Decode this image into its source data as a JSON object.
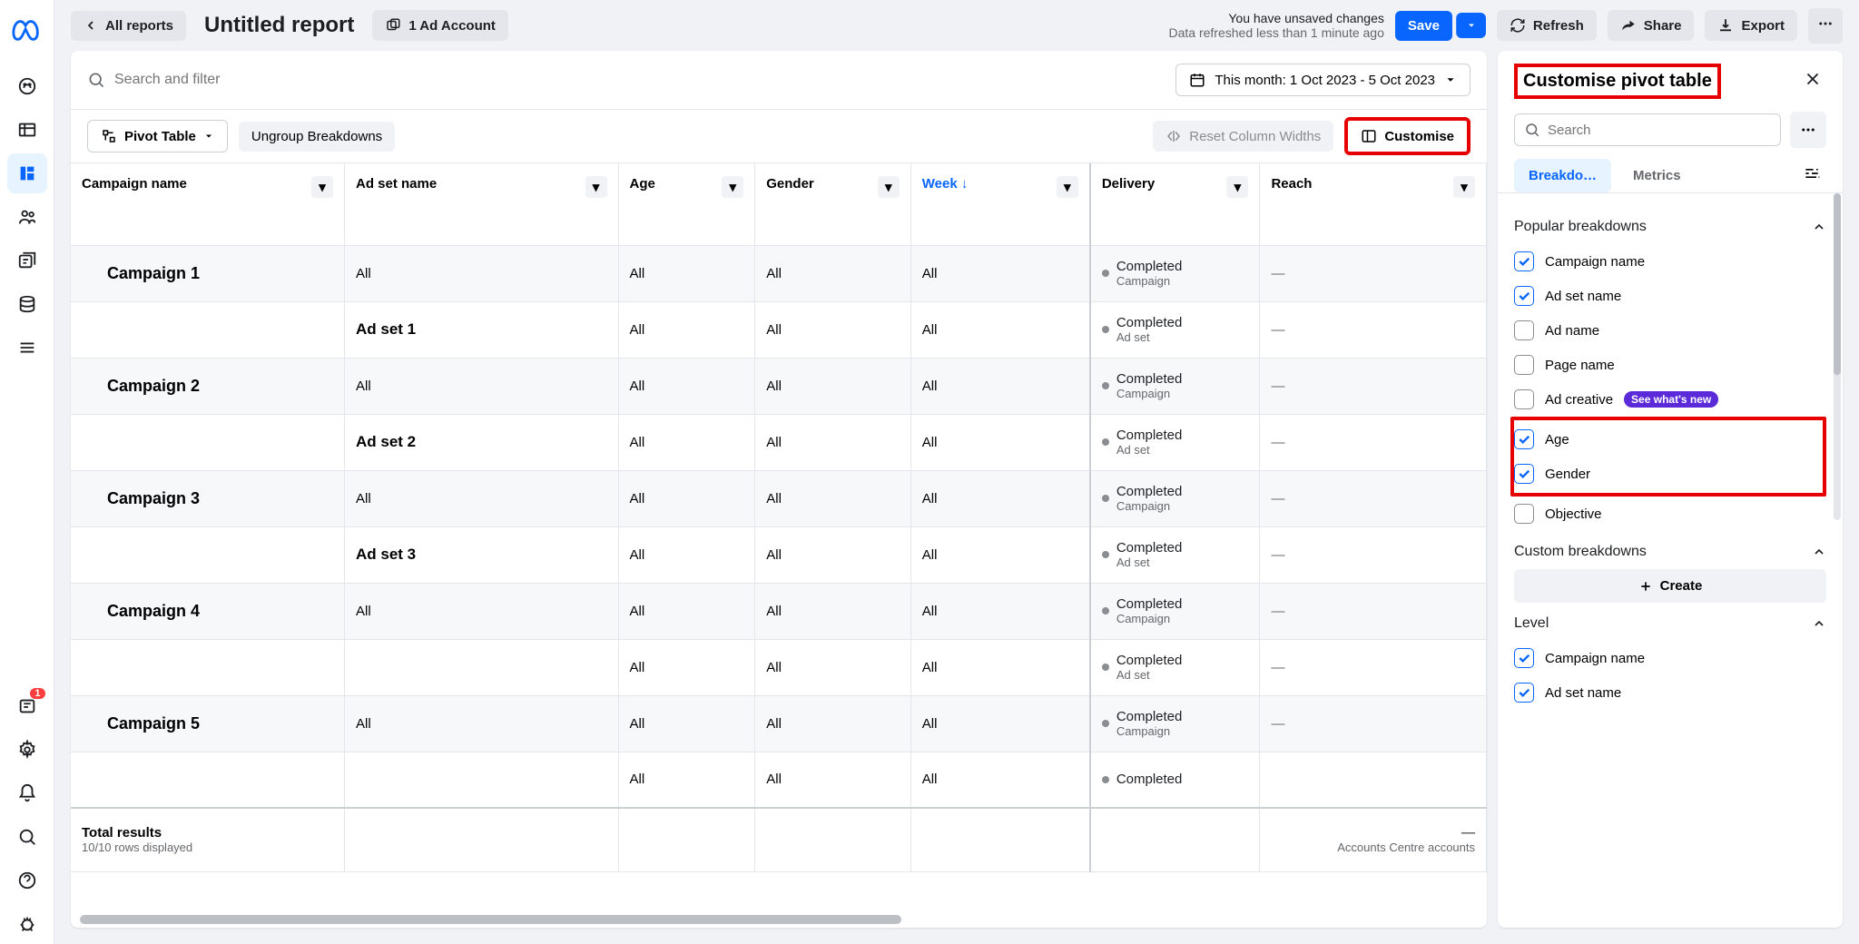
{
  "header": {
    "all_reports": "All reports",
    "title": "Untitled report",
    "ad_account": "1 Ad Account",
    "status_line1": "You have unsaved changes",
    "status_line2": "Data refreshed less than 1 minute ago",
    "save": "Save",
    "refresh": "Refresh",
    "share": "Share",
    "export": "Export"
  },
  "search": {
    "placeholder": "Search and filter",
    "date_range": "This month: 1 Oct 2023 - 5 Oct 2023"
  },
  "toolbar": {
    "pivot": "Pivot Table",
    "ungroup": "Ungroup Breakdowns",
    "reset_widths": "Reset Column Widths",
    "customise": "Customise"
  },
  "columns": {
    "campaign": "Campaign name",
    "adset": "Ad set name",
    "age": "Age",
    "gender": "Gender",
    "week": "Week ↓",
    "delivery": "Delivery",
    "reach": "Reach"
  },
  "rows": [
    {
      "type": "campaign",
      "campaign": "Campaign 1",
      "adset": "All",
      "age": "All",
      "gender": "All",
      "week": "All",
      "delivery": "Completed",
      "delivery_sub": "Campaign",
      "reach": "—"
    },
    {
      "type": "adset",
      "campaign": "",
      "adset": "Ad set 1",
      "age": "All",
      "gender": "All",
      "week": "All",
      "delivery": "Completed",
      "delivery_sub": "Ad set",
      "reach": "—"
    },
    {
      "type": "campaign",
      "campaign": "Campaign 2",
      "adset": "All",
      "age": "All",
      "gender": "All",
      "week": "All",
      "delivery": "Completed",
      "delivery_sub": "Campaign",
      "reach": "—"
    },
    {
      "type": "adset",
      "campaign": "",
      "adset": "Ad set 2",
      "age": "All",
      "gender": "All",
      "week": "All",
      "delivery": "Completed",
      "delivery_sub": "Ad set",
      "reach": "—"
    },
    {
      "type": "campaign",
      "campaign": "Campaign 3",
      "adset": "All",
      "age": "All",
      "gender": "All",
      "week": "All",
      "delivery": "Completed",
      "delivery_sub": "Campaign",
      "reach": "—"
    },
    {
      "type": "adset",
      "campaign": "",
      "adset": "Ad set 3",
      "age": "All",
      "gender": "All",
      "week": "All",
      "delivery": "Completed",
      "delivery_sub": "Ad set",
      "reach": "—"
    },
    {
      "type": "campaign",
      "campaign": "Campaign 4",
      "adset": "All",
      "age": "All",
      "gender": "All",
      "week": "All",
      "delivery": "Completed",
      "delivery_sub": "Campaign",
      "reach": "—"
    },
    {
      "type": "adset",
      "campaign": "",
      "adset": "",
      "age": "All",
      "gender": "All",
      "week": "All",
      "delivery": "Completed",
      "delivery_sub": "Ad set",
      "reach": "—"
    },
    {
      "type": "campaign",
      "campaign": "Campaign 5",
      "adset": "All",
      "age": "All",
      "gender": "All",
      "week": "All",
      "delivery": "Completed",
      "delivery_sub": "Campaign",
      "reach": "—"
    },
    {
      "type": "adset",
      "campaign": "",
      "adset": "",
      "age": "All",
      "gender": "All",
      "week": "All",
      "delivery": "Completed",
      "delivery_sub": "",
      "reach": ""
    }
  ],
  "footer": {
    "total": "Total results",
    "rows": "10/10 rows displayed",
    "reach_dash": "—",
    "reach_label": "Accounts Centre accounts"
  },
  "panel": {
    "title": "Customise pivot table",
    "search_placeholder": "Search",
    "tab_breakdowns": "Breakdo…",
    "tab_metrics": "Metrics",
    "section_popular": "Popular breakdowns",
    "section_custom": "Custom breakdowns",
    "section_level": "Level",
    "create": "Create",
    "new_badge": "See what's new",
    "items_popular": [
      {
        "label": "Campaign name",
        "checked": true
      },
      {
        "label": "Ad set name",
        "checked": true
      },
      {
        "label": "Ad name",
        "checked": false
      },
      {
        "label": "Page name",
        "checked": false
      },
      {
        "label": "Ad creative",
        "checked": false,
        "badge": true
      },
      {
        "label": "Age",
        "checked": true,
        "highlight": true
      },
      {
        "label": "Gender",
        "checked": true,
        "highlight": true
      },
      {
        "label": "Objective",
        "checked": false
      }
    ],
    "items_level": [
      {
        "label": "Campaign name",
        "checked": true
      },
      {
        "label": "Ad set name",
        "checked": true
      }
    ]
  }
}
